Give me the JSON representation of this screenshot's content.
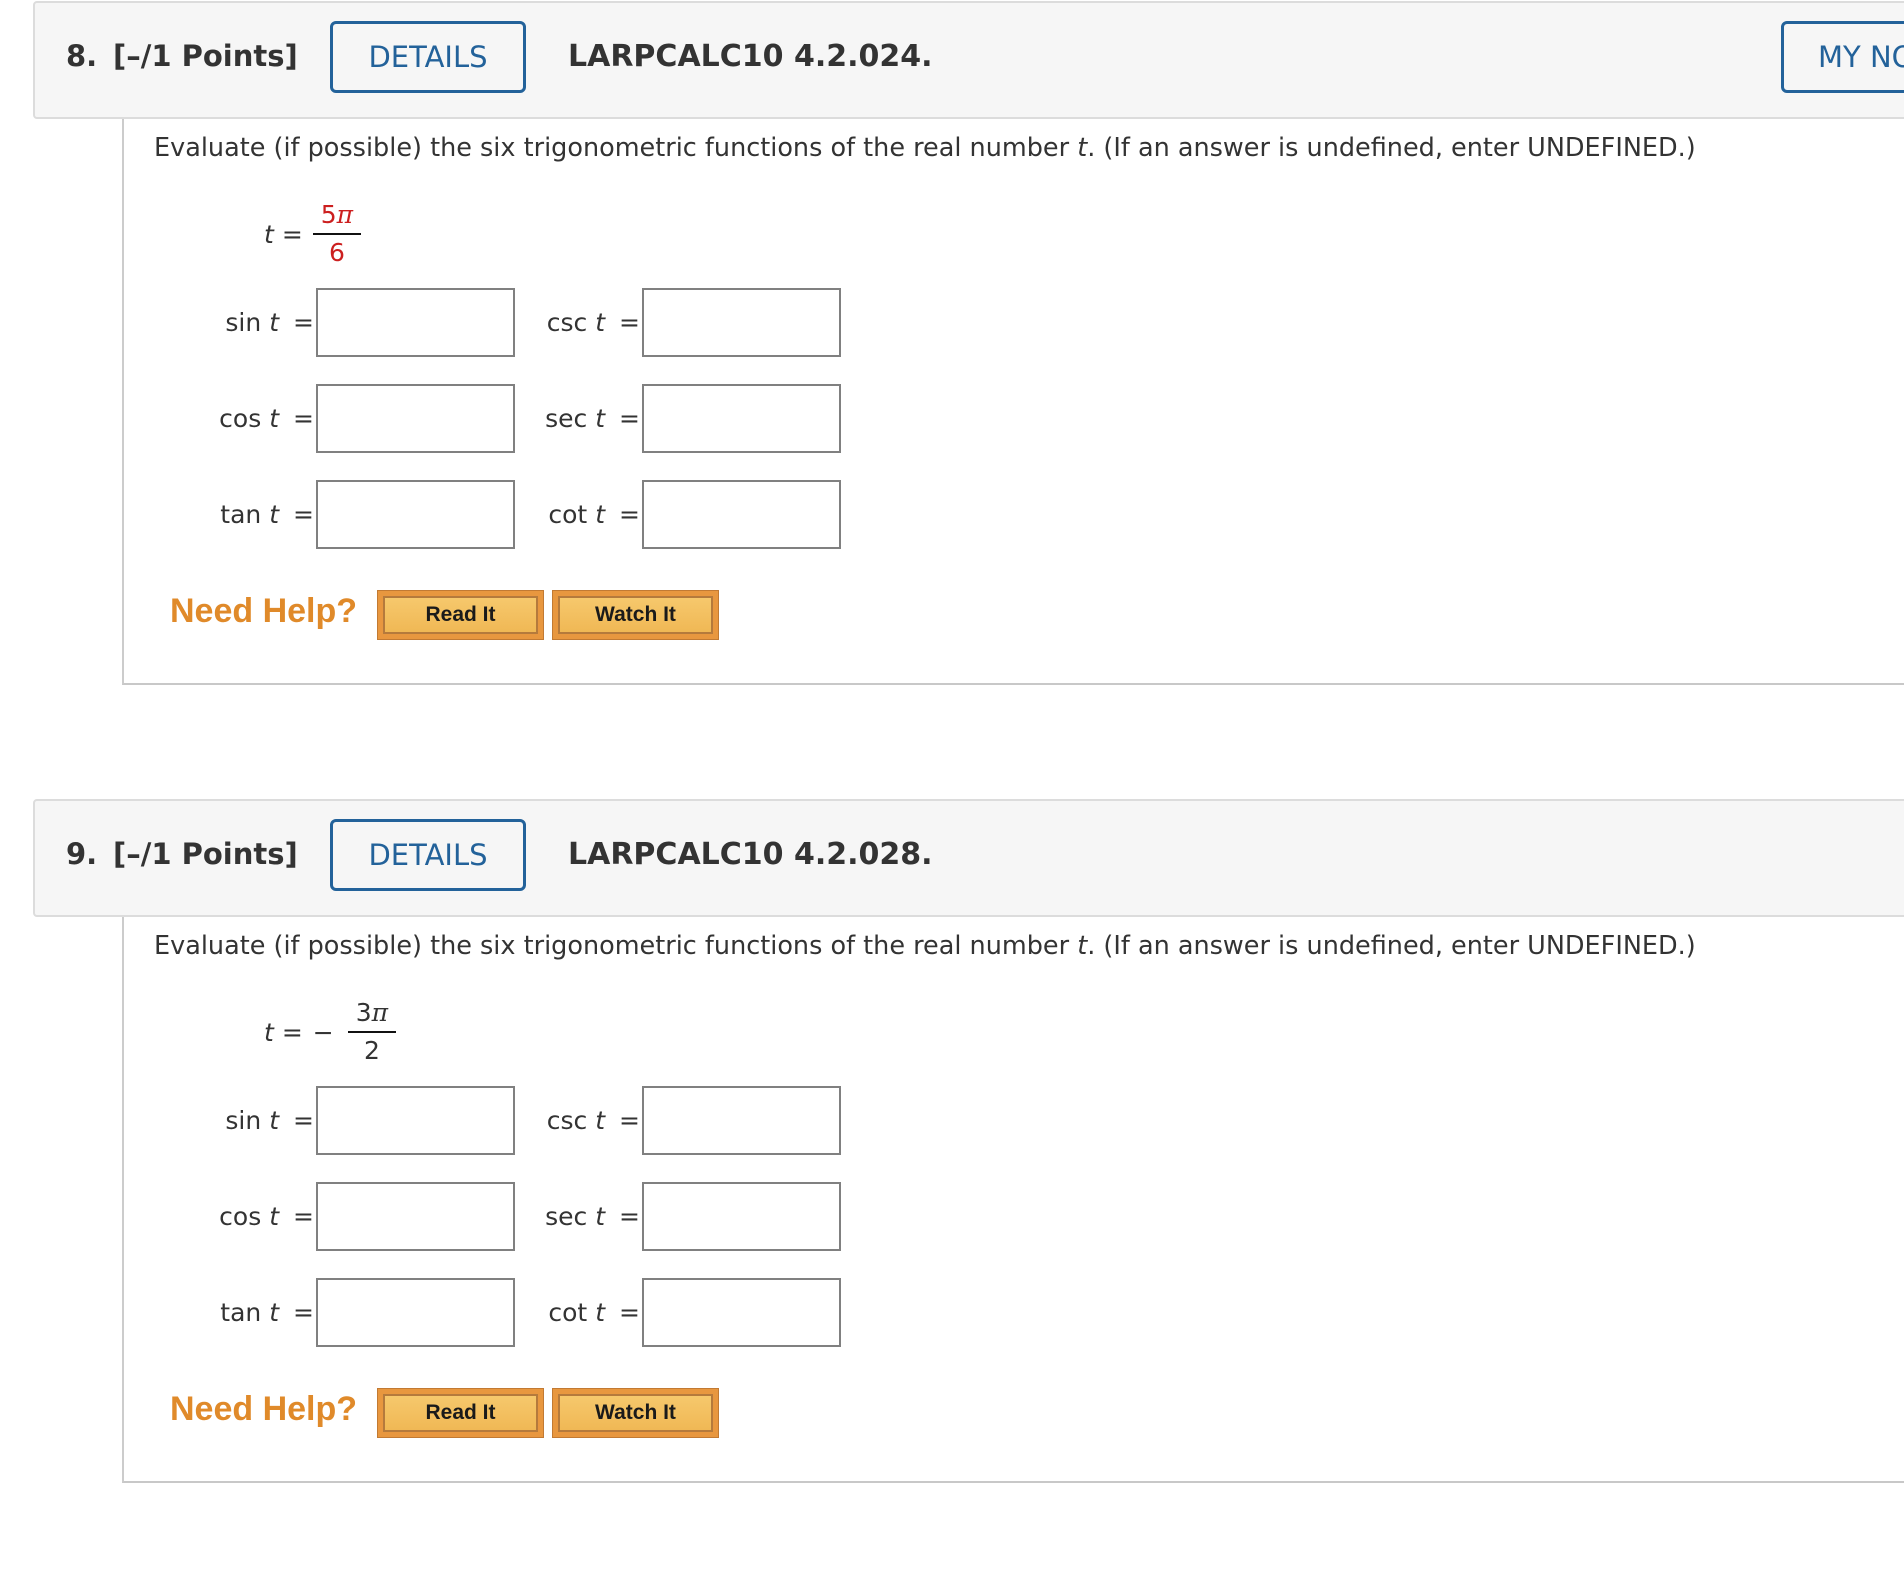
{
  "questions": [
    {
      "number": "8.",
      "points": "[–/1 Points]",
      "details_label": "DETAILS",
      "code": "LARPCALC10 4.2.024.",
      "notes_label": "MY NOTES",
      "prompt_before": "Evaluate (if possible) the six trigonometric functions of the real number ",
      "prompt_var": "t",
      "prompt_after": ". (If an answer is undefined, enter UNDEFINED.)",
      "expression": {
        "lhs": "t",
        "equals": "=",
        "sign": "",
        "numerator": "5",
        "numerator_symbol": "π",
        "denominator": "6",
        "highlight_color": "#cc1f1f"
      },
      "functions_left": [
        {
          "name": "sin",
          "var": "t",
          "equals": "=",
          "value": "",
          "placeholder": ""
        },
        {
          "name": "cos",
          "var": "t",
          "equals": "=",
          "value": "",
          "placeholder": ""
        },
        {
          "name": "tan",
          "var": "t",
          "equals": "=",
          "value": "",
          "placeholder": ""
        }
      ],
      "functions_right": [
        {
          "name": "csc",
          "var": "t",
          "equals": "=",
          "value": "",
          "placeholder": ""
        },
        {
          "name": "sec",
          "var": "t",
          "equals": "=",
          "value": "",
          "placeholder": ""
        },
        {
          "name": "cot",
          "var": "t",
          "equals": "=",
          "value": "",
          "placeholder": ""
        }
      ],
      "help": {
        "label": "Need Help?",
        "read_label": "Read It",
        "watch_label": "Watch It"
      }
    },
    {
      "number": "9.",
      "points": "[–/1 Points]",
      "details_label": "DETAILS",
      "code": "LARPCALC10 4.2.028.",
      "prompt_before": "Evaluate (if possible) the six trigonometric functions of the real number ",
      "prompt_var": "t",
      "prompt_after": ". (If an answer is undefined, enter UNDEFINED.)",
      "expression": {
        "lhs": "t",
        "equals": "=",
        "sign": "−",
        "numerator": "3",
        "numerator_symbol": "π",
        "denominator": "2"
      },
      "functions_left": [
        {
          "name": "sin",
          "var": "t",
          "equals": "=",
          "value": "",
          "placeholder": ""
        },
        {
          "name": "cos",
          "var": "t",
          "equals": "=",
          "value": "",
          "placeholder": ""
        },
        {
          "name": "tan",
          "var": "t",
          "equals": "=",
          "value": "",
          "placeholder": ""
        }
      ],
      "functions_right": [
        {
          "name": "csc",
          "var": "t",
          "equals": "=",
          "value": "",
          "placeholder": ""
        },
        {
          "name": "sec",
          "var": "t",
          "equals": "=",
          "value": "",
          "placeholder": ""
        },
        {
          "name": "cot",
          "var": "t",
          "equals": "=",
          "value": "",
          "placeholder": ""
        }
      ],
      "help": {
        "label": "Need Help?",
        "read_label": "Read It",
        "watch_label": "Watch It"
      }
    }
  ],
  "colors": {
    "accent": "#23629a",
    "help_orange": "#e08a2a",
    "help_button": "#f0b855",
    "highlight_red": "#cc1f1f"
  }
}
